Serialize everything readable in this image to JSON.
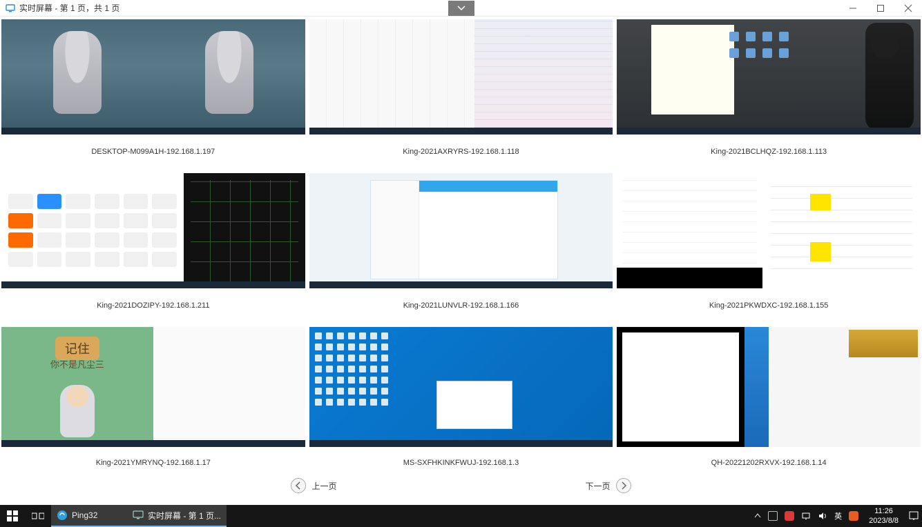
{
  "titlebar": {
    "title": "实时屏幕 - 第 1 页，共 1 页"
  },
  "screens": [
    {
      "name": "DESKTOP-M099A1H",
      "ip": "192.168.1.197",
      "caption": "DESKTOP-M099A1H-192.168.1.197"
    },
    {
      "name": "King-2021AXRYRS",
      "ip": "192.168.1.118",
      "caption": "King-2021AXRYRS-192.168.1.118"
    },
    {
      "name": "King-2021BCLHQZ",
      "ip": "192.168.1.113",
      "caption": "King-2021BCLHQZ-192.168.1.113"
    },
    {
      "name": "King-2021DOZIPY",
      "ip": "192.168.1.211",
      "caption": "King-2021DOZIPY-192.168.1.211"
    },
    {
      "name": "King-2021LUNVLR",
      "ip": "192.168.1.166",
      "caption": "King-2021LUNVLR-192.168.1.166"
    },
    {
      "name": "King-2021PKWDXC",
      "ip": "192.168.1.155",
      "caption": "King-2021PKWDXC-192.168.1.155"
    },
    {
      "name": "King-2021YMRYNQ",
      "ip": "192.168.1.17",
      "caption": "King-2021YMRYNQ-192.168.1.17"
    },
    {
      "name": "MS-SXFHKINKFWUJ",
      "ip": "192.168.1.3",
      "caption": "MS-SXFHKINKFWUJ-192.168.1.3"
    },
    {
      "name": "QH-20221202RXVX",
      "ip": "192.168.1.14",
      "caption": "QH-20221202RXVX-192.168.1.14"
    }
  ],
  "pager": {
    "prev": "上一页",
    "next": "下一页"
  },
  "taskbar": {
    "apps": [
      {
        "name": "Ping32",
        "label": "Ping32",
        "icon_color": "#2da0e0"
      },
      {
        "name": "realtime-screen",
        "label": "实时屏幕 - 第 1 页...",
        "icon_color": "#4a88c8"
      }
    ],
    "ime": "英",
    "time": "11:26",
    "date": "2023/8/8"
  },
  "thumb_text": {
    "monk_title": "记住",
    "monk_sub": "你不是凡尘三"
  }
}
